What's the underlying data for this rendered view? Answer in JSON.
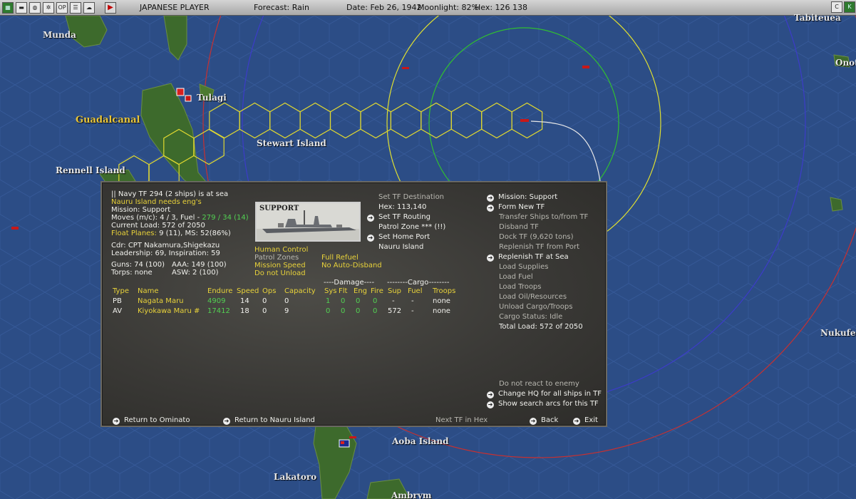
{
  "toolbar": {
    "player": "JAPANESE PLAYER",
    "forecast": "Forecast: Rain",
    "date": "Date: Feb 26, 1942",
    "moonlight": "Moonlight: 82%",
    "hex": "Hex: 126  138",
    "icons": [
      "map-icon",
      "group-icon",
      "globe-icon",
      "gear-icon",
      "ops-report-icon",
      "list-icon",
      "cloud-icon",
      "play-icon"
    ],
    "right_icons": [
      "c-icon",
      "k-icon"
    ]
  },
  "map_labels": {
    "munda": "Munda",
    "tulagi": "Tulagi",
    "guadalcanal": "Guadalcanal",
    "stewart": "Stewart Island",
    "rennell": "Rennell Island",
    "tabiteuea": "Tabiteuea",
    "onotoa": "Onot",
    "nukufetau": "Nukufet",
    "aoba": "Aoba Island",
    "lakatoro": "Lakatoro",
    "ambrym": "Ambrym"
  },
  "tf": {
    "header": "|| Navy TF 294 (2 ships) is at sea",
    "eng_warning": "Nauru Island needs eng's",
    "mission": "Mission: Support",
    "moves_prefix": "Moves (m/c): 4 / 3, Fuel - ",
    "moves_fuel": "279 / 34 (14)",
    "current_load": "Current Load: 572 of 2050",
    "float_planes_label": "Float Planes:",
    "float_planes_value": " 9 (11), MS: 52(86%)",
    "cdr": "Cdr: CPT  Nakamura,Shigekazu",
    "leadership": "Leadership: 69, Inspiration: 59",
    "guns": "Guns: 74 (100)",
    "aaa": "AAA: 149 (100)",
    "torps": "Torps: none",
    "asw": "ASW: 2 (100)",
    "photo_label": "SUPPORT",
    "human_control": "Human Control",
    "patrol_zones": "Patrol Zones",
    "mission_speed": "Mission Speed",
    "do_not_unload": "Do not Unload",
    "full_refuel": "Full Refuel",
    "no_auto_disband": "No Auto-Disband",
    "set_destination": "Set TF Destination",
    "hex": "Hex: 113,140",
    "set_routing": "Set TF Routing",
    "patrol_zone": "Patrol Zone *** (!!)",
    "set_home_port": "Set Home Port",
    "home_port": "Nauru Island",
    "damage_group": "----Damage----",
    "cargo_group": "--------Cargo--------",
    "columns": [
      "Type",
      "Name",
      "Endure",
      "Speed",
      "Ops",
      "Capacity",
      "Sys",
      "Flt",
      "Eng",
      "Fire",
      "Sup",
      "Fuel",
      "Troops"
    ],
    "ships": [
      {
        "type": "PB",
        "name": "Nagata Maru",
        "endure": "4909",
        "speed": "14",
        "ops": "0",
        "capacity": "0",
        "sys": "1",
        "flt": "0",
        "eng": "0",
        "fire": "0",
        "sup": "-",
        "fuel": "-",
        "troops": "none"
      },
      {
        "type": "AV",
        "name": "Kiyokawa Maru #",
        "endure": "17412",
        "speed": "18",
        "ops": "0",
        "capacity": "9",
        "sys": "0",
        "flt": "0",
        "eng": "0",
        "fire": "0",
        "sup": "572",
        "fuel": "-",
        "troops": "none"
      }
    ],
    "right_menu": {
      "mission_support": "Mission: Support",
      "form_new_tf": "Form New TF",
      "transfer_ships": "Transfer Ships to/from TF",
      "disband_tf": "Disband TF",
      "dock_tf": "Dock TF (9,620 tons)",
      "replenish_port": "Replenish TF from Port",
      "replenish_sea": "Replenish TF at Sea",
      "load_supplies": "Load Supplies",
      "load_fuel": "Load Fuel",
      "load_troops": "Load Troops",
      "load_oil": "Load Oil/Resources",
      "unload_cargo": "Unload Cargo/Troops",
      "cargo_status": "Cargo Status: Idle",
      "total_load": "Total Load: 572 of 2050",
      "no_react": "Do not react to enemy",
      "change_hq": "Change HQ for all ships in TF",
      "show_arcs": "Show search arcs for this TF"
    },
    "bottom": {
      "return_ominato": "Return to Ominato",
      "return_nauru": "Return to Nauru Island",
      "next_tf": "Next TF in Hex",
      "back": "Back",
      "exit": "Exit"
    }
  }
}
